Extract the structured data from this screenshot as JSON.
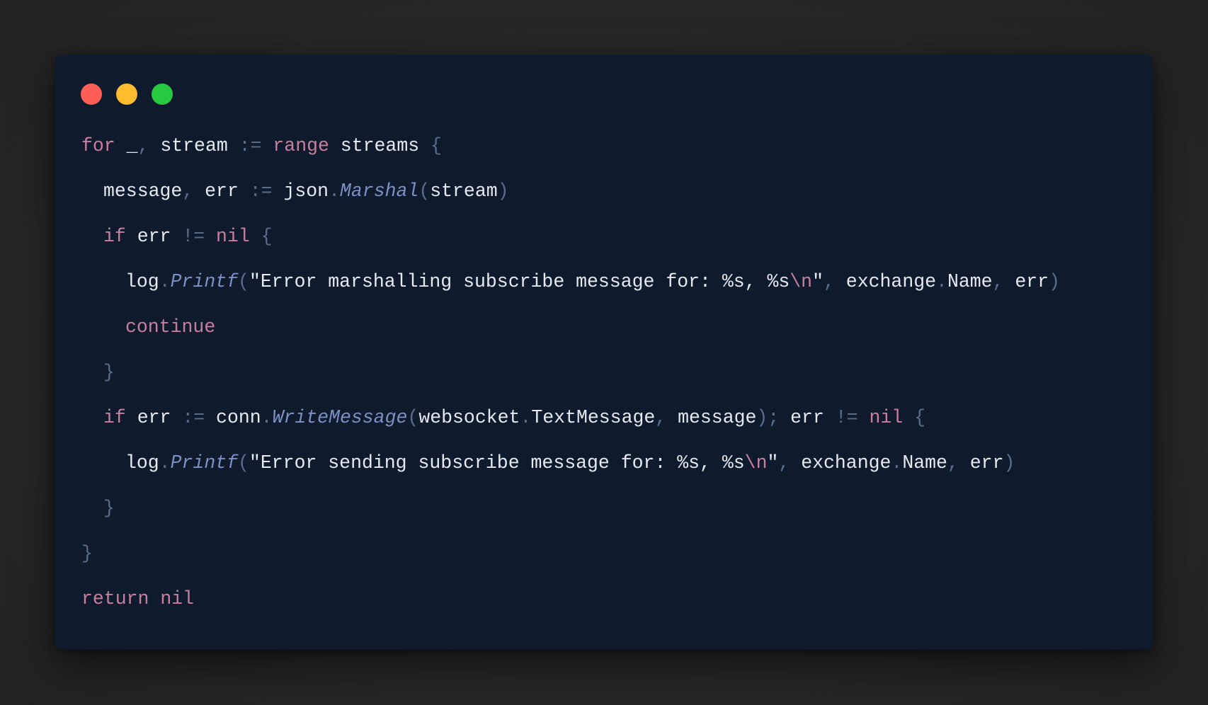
{
  "window": {
    "controls": {
      "close_color": "#ff5f57",
      "minimize_color": "#febc2e",
      "zoom_color": "#28c840"
    }
  },
  "code": {
    "language": "go",
    "lines": [
      {
        "indent": 0,
        "tokens": [
          {
            "t": "for",
            "c": "kw"
          },
          {
            "t": " _",
            "c": "id"
          },
          {
            "t": ",",
            "c": "punc"
          },
          {
            "t": " stream ",
            "c": "id"
          },
          {
            "t": ":=",
            "c": "punc"
          },
          {
            "t": " ",
            "c": "id"
          },
          {
            "t": "range",
            "c": "kw"
          },
          {
            "t": " streams ",
            "c": "id"
          },
          {
            "t": "{",
            "c": "punc"
          }
        ]
      },
      {
        "indent": 1,
        "tokens": [
          {
            "t": "message",
            "c": "id"
          },
          {
            "t": ",",
            "c": "punc"
          },
          {
            "t": " err ",
            "c": "id"
          },
          {
            "t": ":=",
            "c": "punc"
          },
          {
            "t": " json",
            "c": "id"
          },
          {
            "t": ".",
            "c": "punc"
          },
          {
            "t": "Marshal",
            "c": "fn"
          },
          {
            "t": "(",
            "c": "punc"
          },
          {
            "t": "stream",
            "c": "id"
          },
          {
            "t": ")",
            "c": "punc"
          }
        ]
      },
      {
        "indent": 1,
        "tokens": [
          {
            "t": "if",
            "c": "kw"
          },
          {
            "t": " err ",
            "c": "id"
          },
          {
            "t": "!=",
            "c": "punc"
          },
          {
            "t": " ",
            "c": "id"
          },
          {
            "t": "nil",
            "c": "kw"
          },
          {
            "t": " ",
            "c": "id"
          },
          {
            "t": "{",
            "c": "punc"
          }
        ]
      },
      {
        "indent": 2,
        "tokens": [
          {
            "t": "log",
            "c": "id"
          },
          {
            "t": ".",
            "c": "punc"
          },
          {
            "t": "Printf",
            "c": "fn"
          },
          {
            "t": "(",
            "c": "punc"
          },
          {
            "t": "\"Error marshalling subscribe message for: %s, %s",
            "c": "str"
          },
          {
            "t": "\\n",
            "c": "esc"
          },
          {
            "t": "\"",
            "c": "str"
          },
          {
            "t": ",",
            "c": "punc"
          },
          {
            "t": " exchange",
            "c": "id"
          },
          {
            "t": ".",
            "c": "punc"
          },
          {
            "t": "Name",
            "c": "id"
          },
          {
            "t": ",",
            "c": "punc"
          },
          {
            "t": " err",
            "c": "id"
          },
          {
            "t": ")",
            "c": "punc"
          }
        ]
      },
      {
        "indent": 2,
        "tokens": [
          {
            "t": "continue",
            "c": "kw"
          }
        ]
      },
      {
        "indent": 1,
        "tokens": [
          {
            "t": "}",
            "c": "punc"
          }
        ]
      },
      {
        "indent": 1,
        "tokens": [
          {
            "t": "if",
            "c": "kw"
          },
          {
            "t": " err ",
            "c": "id"
          },
          {
            "t": ":=",
            "c": "punc"
          },
          {
            "t": " conn",
            "c": "id"
          },
          {
            "t": ".",
            "c": "punc"
          },
          {
            "t": "WriteMessage",
            "c": "fn"
          },
          {
            "t": "(",
            "c": "punc"
          },
          {
            "t": "websocket",
            "c": "id"
          },
          {
            "t": ".",
            "c": "punc"
          },
          {
            "t": "TextMessage",
            "c": "id"
          },
          {
            "t": ",",
            "c": "punc"
          },
          {
            "t": " message",
            "c": "id"
          },
          {
            "t": ")",
            "c": "punc"
          },
          {
            "t": ";",
            "c": "punc"
          },
          {
            "t": " err ",
            "c": "id"
          },
          {
            "t": "!=",
            "c": "punc"
          },
          {
            "t": " ",
            "c": "id"
          },
          {
            "t": "nil",
            "c": "kw"
          },
          {
            "t": " ",
            "c": "id"
          },
          {
            "t": "{",
            "c": "punc"
          }
        ]
      },
      {
        "indent": 2,
        "tokens": [
          {
            "t": "log",
            "c": "id"
          },
          {
            "t": ".",
            "c": "punc"
          },
          {
            "t": "Printf",
            "c": "fn"
          },
          {
            "t": "(",
            "c": "punc"
          },
          {
            "t": "\"Error sending subscribe message for: %s, %s",
            "c": "str"
          },
          {
            "t": "\\n",
            "c": "esc"
          },
          {
            "t": "\"",
            "c": "str"
          },
          {
            "t": ",",
            "c": "punc"
          },
          {
            "t": " exchange",
            "c": "id"
          },
          {
            "t": ".",
            "c": "punc"
          },
          {
            "t": "Name",
            "c": "id"
          },
          {
            "t": ",",
            "c": "punc"
          },
          {
            "t": " err",
            "c": "id"
          },
          {
            "t": ")",
            "c": "punc"
          }
        ]
      },
      {
        "indent": 1,
        "tokens": [
          {
            "t": "}",
            "c": "punc"
          }
        ]
      },
      {
        "indent": 0,
        "tokens": [
          {
            "t": "}",
            "c": "punc"
          }
        ]
      },
      {
        "indent": 0,
        "tokens": [
          {
            "t": "return",
            "c": "kw"
          },
          {
            "t": " ",
            "c": "id"
          },
          {
            "t": "nil",
            "c": "kw"
          }
        ]
      }
    ]
  }
}
